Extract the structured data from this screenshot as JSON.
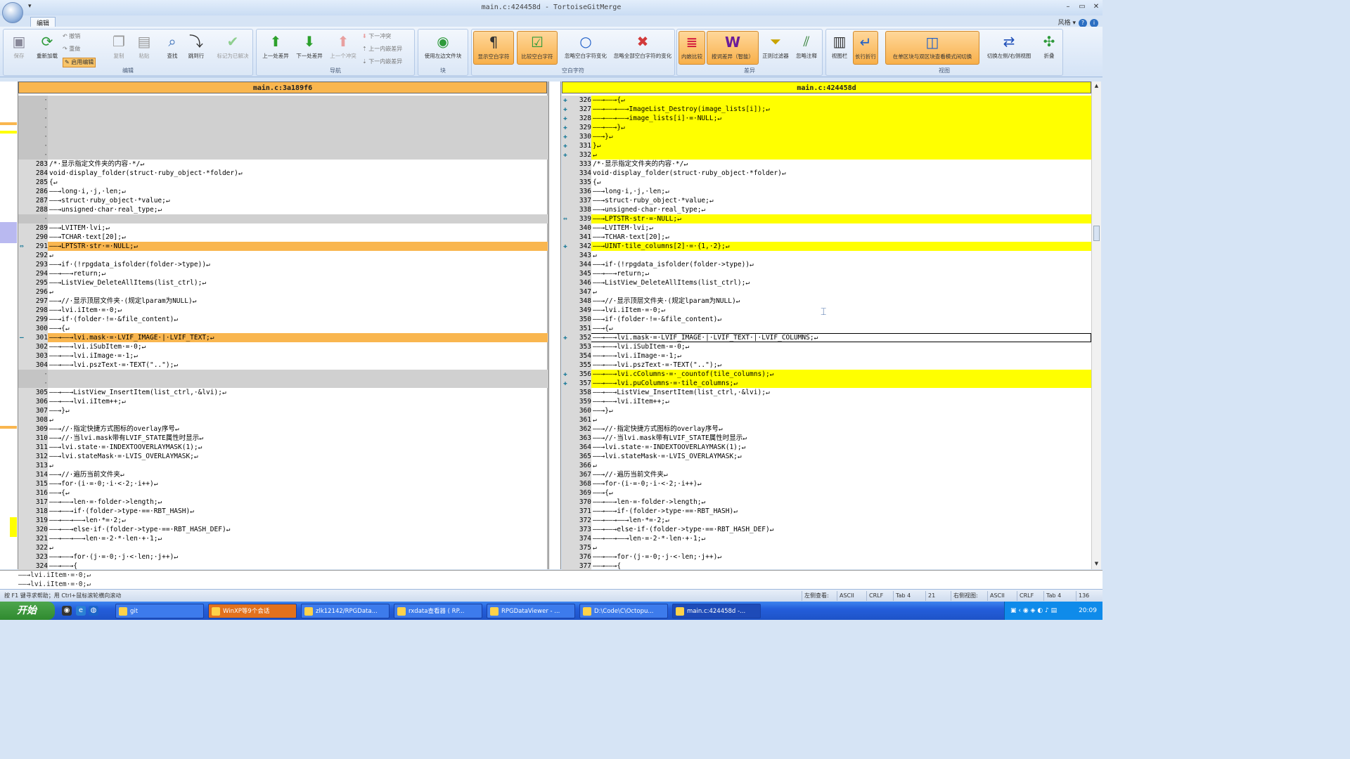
{
  "window": {
    "title": "main.c:424458d - TortoiseGitMerge",
    "qat": "▾",
    "style_label": "风格 ▾"
  },
  "ribbon_tabs": [
    "编辑"
  ],
  "ribbon_groups": [
    {
      "label": "编辑",
      "buttons": [
        "保存",
        "重新加载",
        "复制",
        "粘贴",
        "查找",
        "跳到行",
        "标记为已解决"
      ],
      "small": [
        "撤销",
        "重做",
        "启用编辑"
      ]
    },
    {
      "label": "导航",
      "buttons": [
        "上一处差异",
        "下一处差异",
        "上一个冲突"
      ],
      "small": [
        "下一冲突",
        "上一内嵌差异",
        "下一内嵌差异"
      ]
    },
    {
      "label": "块",
      "buttons": [
        "使用左边文件块"
      ]
    },
    {
      "label": "空白字符",
      "buttons": [
        "显示空白字符",
        "比较空白字符",
        "忽略空白字符变化",
        "忽略全部空白字符的变化"
      ]
    },
    {
      "label": "差异",
      "buttons": [
        "内嵌比较",
        "按词差异（智能）",
        "正则过滤器",
        "忽略注释"
      ]
    },
    {
      "label": "视图",
      "buttons": [
        "视图栏",
        "长行折行",
        "在单区块与双区块查看模式间切换",
        "切换左侧/右侧视图",
        "折叠"
      ]
    }
  ],
  "left_panel": {
    "header": "main.c:3a189f6",
    "lines": [
      {
        "n": "·",
        "t": "",
        "k": "empty"
      },
      {
        "n": "·",
        "t": "",
        "k": "empty"
      },
      {
        "n": "·",
        "t": "",
        "k": "empty"
      },
      {
        "n": "·",
        "t": "",
        "k": "empty"
      },
      {
        "n": "·",
        "t": "",
        "k": "empty"
      },
      {
        "n": "·",
        "t": "",
        "k": "empty"
      },
      {
        "n": "·",
        "t": "",
        "k": "empty"
      },
      {
        "n": "283",
        "t": "/*·显示指定文件夹的内容·*/↵"
      },
      {
        "n": "284",
        "t": "void·display_folder(struct·ruby_object·*folder)↵"
      },
      {
        "n": "285",
        "t": "{↵"
      },
      {
        "n": "286",
        "t": "——→long·i,·j,·len;↵"
      },
      {
        "n": "287",
        "t": "——→struct·ruby_object·*value;↵"
      },
      {
        "n": "288",
        "t": "——→unsigned·char·real_type;↵"
      },
      {
        "n": "·",
        "t": "",
        "k": "empty"
      },
      {
        "n": "289",
        "t": "——→LVITEM·lvi;↵"
      },
      {
        "n": "290",
        "t": "——→TCHAR·text[20];↵"
      },
      {
        "n": "291",
        "t": "——→LPTSTR·str·=·NULL;↵",
        "k": "chg",
        "g": "⇔"
      },
      {
        "n": "292",
        "t": "↵"
      },
      {
        "n": "293",
        "t": "——→if·(!rpgdata_isfolder(folder->type))↵"
      },
      {
        "n": "294",
        "t": "——→——→return;↵"
      },
      {
        "n": "295",
        "t": "——→ListView_DeleteAllItems(list_ctrl);↵"
      },
      {
        "n": "296",
        "t": "↵"
      },
      {
        "n": "297",
        "t": "——→//·显示顶层文件夹·(规定lparam为NULL)↵"
      },
      {
        "n": "298",
        "t": "——→lvi.iItem·=·0;↵"
      },
      {
        "n": "299",
        "t": "——→if·(folder·!=·&file_content)↵"
      },
      {
        "n": "300",
        "t": "——→{↵"
      },
      {
        "n": "301",
        "t": "——→——→lvi.mask·=·LVIF_IMAGE·|·LVIF_TEXT;↵",
        "k": "chg",
        "g": "—"
      },
      {
        "n": "302",
        "t": "——→——→lvi.iSubItem·=·0;↵"
      },
      {
        "n": "303",
        "t": "——→——→lvi.iImage·=·1;↵"
      },
      {
        "n": "304",
        "t": "——→——→lvi.pszText·=·TEXT(\"..\");↵"
      },
      {
        "n": "·",
        "t": "",
        "k": "empty"
      },
      {
        "n": "·",
        "t": "",
        "k": "empty"
      },
      {
        "n": "305",
        "t": "——→——→ListView_InsertItem(list_ctrl,·&lvi);↵"
      },
      {
        "n": "306",
        "t": "——→——→lvi.iItem++;↵"
      },
      {
        "n": "307",
        "t": "——→}↵"
      },
      {
        "n": "308",
        "t": "↵"
      },
      {
        "n": "309",
        "t": "——→//·指定快捷方式图标的overlay序号↵"
      },
      {
        "n": "310",
        "t": "——→//·当lvi.mask带有LVIF_STATE属性时显示↵"
      },
      {
        "n": "311",
        "t": "——→lvi.state·=·INDEXTOOVERLAYMASK(1);↵"
      },
      {
        "n": "312",
        "t": "——→lvi.stateMask·=·LVIS_OVERLAYMASK;↵"
      },
      {
        "n": "313",
        "t": "↵"
      },
      {
        "n": "314",
        "t": "——→//·遍历当前文件夹↵"
      },
      {
        "n": "315",
        "t": "——→for·(i·=·0;·i·<·2;·i++)↵"
      },
      {
        "n": "316",
        "t": "——→{↵"
      },
      {
        "n": "317",
        "t": "——→——→len·=·folder->length;↵"
      },
      {
        "n": "318",
        "t": "——→——→if·(folder->type·==·RBT_HASH)↵"
      },
      {
        "n": "319",
        "t": "——→——→——→len·*=·2;↵"
      },
      {
        "n": "320",
        "t": "——→——→else·if·(folder->type·==·RBT_HASH_DEF)↵"
      },
      {
        "n": "321",
        "t": "——→——→——→len·=·2·*·len·+·1;↵"
      },
      {
        "n": "322",
        "t": "↵"
      },
      {
        "n": "323",
        "t": "——→——→for·(j·=·0;·j·<·len;·j++)↵"
      },
      {
        "n": "324",
        "t": "——→——→{"
      }
    ]
  },
  "right_panel": {
    "header": "main.c:424458d",
    "lines": [
      {
        "n": "326",
        "t": "——→——→{↵",
        "k": "chg",
        "g": "✚"
      },
      {
        "n": "327",
        "t": "——→——→——→ImageList_Destroy(image_lists[i]);↵",
        "k": "chg",
        "g": "✚"
      },
      {
        "n": "328",
        "t": "——→——→——→image_lists[i]·=·NULL;↵",
        "k": "chg",
        "g": "✚"
      },
      {
        "n": "329",
        "t": "——→——→}↵",
        "k": "chg",
        "g": "✚"
      },
      {
        "n": "330",
        "t": "——→}↵",
        "k": "chg",
        "g": "✚"
      },
      {
        "n": "331",
        "t": "}↵",
        "k": "chg",
        "g": "✚"
      },
      {
        "n": "332",
        "t": "↵",
        "k": "chg",
        "g": "✚"
      },
      {
        "n": "333",
        "t": "/*·显示指定文件夹的内容·*/↵"
      },
      {
        "n": "334",
        "t": "void·display_folder(struct·ruby_object·*folder)↵"
      },
      {
        "n": "335",
        "t": "{↵"
      },
      {
        "n": "336",
        "t": "——→long·i,·j,·len;↵"
      },
      {
        "n": "337",
        "t": "——→struct·ruby_object·*value;↵"
      },
      {
        "n": "338",
        "t": "——→unsigned·char·real_type;↵"
      },
      {
        "n": "339",
        "t": "——→LPTSTR·str·=·NULL;↵",
        "k": "chg",
        "g": "⇔"
      },
      {
        "n": "340",
        "t": "——→LVITEM·lvi;↵"
      },
      {
        "n": "341",
        "t": "——→TCHAR·text[20];↵"
      },
      {
        "n": "342",
        "t": "——→UINT·tile_columns[2]·=·{1,·2};↵",
        "k": "chg",
        "g": "✚"
      },
      {
        "n": "343",
        "t": "↵"
      },
      {
        "n": "344",
        "t": "——→if·(!rpgdata_isfolder(folder->type))↵"
      },
      {
        "n": "345",
        "t": "——→——→return;↵"
      },
      {
        "n": "346",
        "t": "——→ListView_DeleteAllItems(list_ctrl);↵"
      },
      {
        "n": "347",
        "t": "↵"
      },
      {
        "n": "348",
        "t": "——→//·显示顶层文件夹·(规定lparam为NULL)↵"
      },
      {
        "n": "349",
        "t": "——→lvi.iItem·=·0;↵"
      },
      {
        "n": "350",
        "t": "——→if·(folder·!=·&file_content)↵"
      },
      {
        "n": "351",
        "t": "——→{↵"
      },
      {
        "n": "352",
        "t": "——→——→lvi.mask·=·LVIF_IMAGE·|·LVIF_TEXT·|·LVIF_COLUMNS;↵",
        "k": "sel",
        "g": "✚"
      },
      {
        "n": "353",
        "t": "——→——→lvi.iSubItem·=·0;↵"
      },
      {
        "n": "354",
        "t": "——→——→lvi.iImage·=·1;↵"
      },
      {
        "n": "355",
        "t": "——→——→lvi.pszText·=·TEXT(\"..\");↵"
      },
      {
        "n": "356",
        "t": "——→——→lvi.cColumns·=·_countof(tile_columns);↵",
        "k": "chg",
        "g": "✚"
      },
      {
        "n": "357",
        "t": "——→——→lvi.puColumns·=·tile_columns;↵",
        "k": "chg",
        "g": "✚"
      },
      {
        "n": "358",
        "t": "——→——→ListView_InsertItem(list_ctrl,·&lvi);↵"
      },
      {
        "n": "359",
        "t": "——→——→lvi.iItem++;↵"
      },
      {
        "n": "360",
        "t": "——→}↵"
      },
      {
        "n": "361",
        "t": "↵"
      },
      {
        "n": "362",
        "t": "——→//·指定快捷方式图标的overlay序号↵"
      },
      {
        "n": "363",
        "t": "——→//·当lvi.mask带有LVIF_STATE属性时显示↵"
      },
      {
        "n": "364",
        "t": "——→lvi.state·=·INDEXTOOVERLAYMASK(1);↵"
      },
      {
        "n": "365",
        "t": "——→lvi.stateMask·=·LVIS_OVERLAYMASK;↵"
      },
      {
        "n": "366",
        "t": "↵"
      },
      {
        "n": "367",
        "t": "——→//·遍历当前文件夹↵"
      },
      {
        "n": "368",
        "t": "——→for·(i·=·0;·i·<·2;·i++)↵"
      },
      {
        "n": "369",
        "t": "——→{↵"
      },
      {
        "n": "370",
        "t": "——→——→len·=·folder->length;↵"
      },
      {
        "n": "371",
        "t": "——→——→if·(folder->type·==·RBT_HASH)↵"
      },
      {
        "n": "372",
        "t": "——→——→——→len·*=·2;↵"
      },
      {
        "n": "373",
        "t": "——→——→else·if·(folder->type·==·RBT_HASH_DEF)↵"
      },
      {
        "n": "374",
        "t": "——→——→——→len·=·2·*·len·+·1;↵"
      },
      {
        "n": "375",
        "t": "↵"
      },
      {
        "n": "376",
        "t": "——→——→for·(j·=·0;·j·<·len;·j++)↵"
      },
      {
        "n": "377",
        "t": "——→——→{"
      }
    ]
  },
  "bottom_pane": [
    "——→lvi.iItem·=·0;↵",
    "——→lvi.iItem·=·0;↵"
  ],
  "status": {
    "help": "按 F1 键寻求帮助；用 Ctrl+鼠标滚轮横向滚动",
    "left_view": "左侧查看:",
    "left_enc": "ASCII",
    "left_eol": "CRLF",
    "left_tab": "Tab 4",
    "left_line": "21",
    "right_view": "右侧视图:",
    "right_enc": "ASCII",
    "right_eol": "CRLF",
    "right_tab": "Tab 4",
    "right_line": "136"
  },
  "taskbar": {
    "start": "开始",
    "tasks": [
      "git",
      "WinXP等9个会话",
      "zlk12142/RPGData...",
      "rxdata查看器 ( RP...",
      "RPGDataViewer - ...",
      "D:\\Code\\C\\Octopu...",
      "main.c:424458d -..."
    ],
    "clock": "20:09"
  },
  "colors": {
    "changed_left": "#f9b64f",
    "changed_right": "#ffff00",
    "empty": "#d0d0d0",
    "taskbar": "#245edb"
  }
}
